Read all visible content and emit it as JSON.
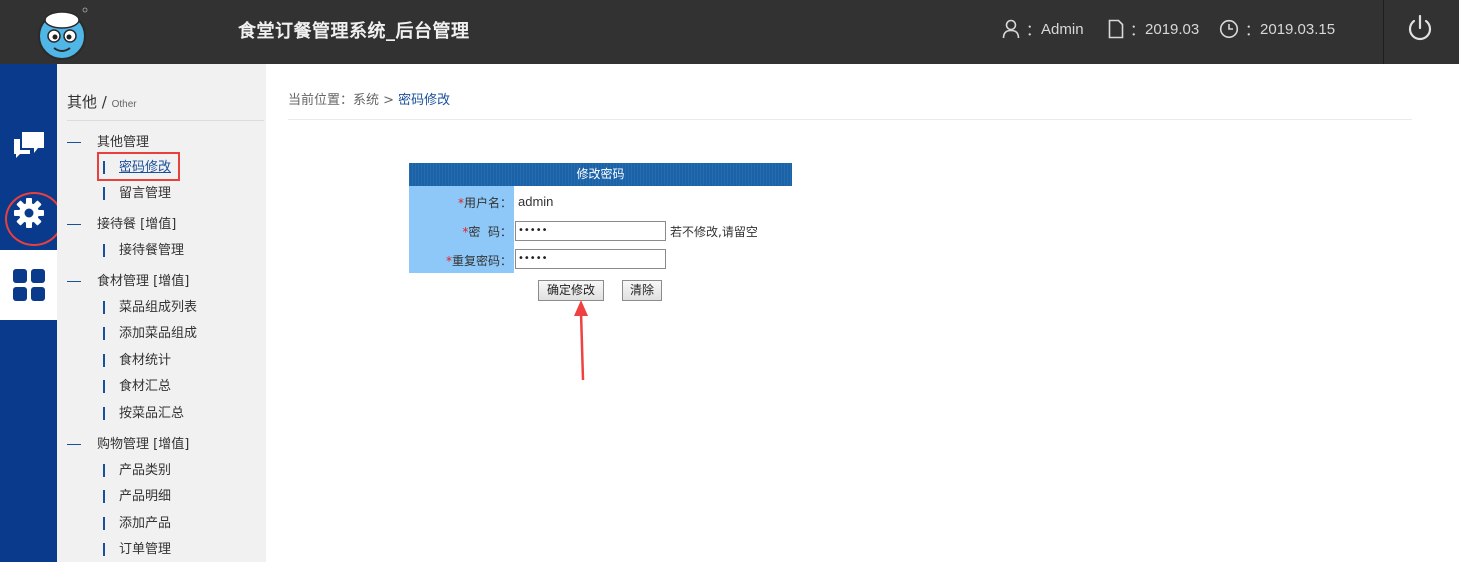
{
  "header": {
    "title": "食堂订餐管理系统_后台管理",
    "user": "Admin",
    "month": "2019.03",
    "date": "2019.03.15",
    "sep": "："
  },
  "icons": {
    "logo": "mascot-logo",
    "user": "user-icon",
    "month": "document-icon",
    "date": "clock-icon",
    "power": "power-icon",
    "rail": [
      "chat-icon",
      "gear-icon",
      "grid-icon"
    ]
  },
  "sidebar": {
    "heading": "其他",
    "heading_sep": " / ",
    "heading_sub": "Other",
    "groups": [
      {
        "label": "其他管理",
        "items": [
          "密码修改",
          "留言管理"
        ]
      },
      {
        "label": "接待餐 [增值]",
        "items": [
          "接待餐管理"
        ]
      },
      {
        "label": "食材管理 [增值]",
        "items": [
          "菜品组成列表",
          "添加菜品组成",
          "食材统计",
          "食材汇总",
          "按菜品汇总"
        ]
      },
      {
        "label": "购物管理 [增值]",
        "items": [
          "产品类别",
          "产品明细",
          "添加产品",
          "订单管理"
        ]
      }
    ],
    "active": "密码修改"
  },
  "breadcrumb": {
    "prefix": "当前位置：系统 > ",
    "current": "密码修改"
  },
  "form": {
    "title": "修改密码",
    "username_label": "用户名：",
    "username_value": "admin",
    "password_label": "密  码：",
    "password_value": "•••••",
    "repeat_label": "重复密码：",
    "repeat_value": "•••••",
    "required_mark": "*",
    "hint": "若不修改,请留空",
    "submit_label": "确定修改",
    "clear_label": "清除"
  },
  "colors": {
    "header_bg": "#323232",
    "rail_bg": "#0a3a8c",
    "form_head_bg": "#1b63a8",
    "label_bg": "#8ec8f8",
    "highlight": "#e8403c"
  }
}
